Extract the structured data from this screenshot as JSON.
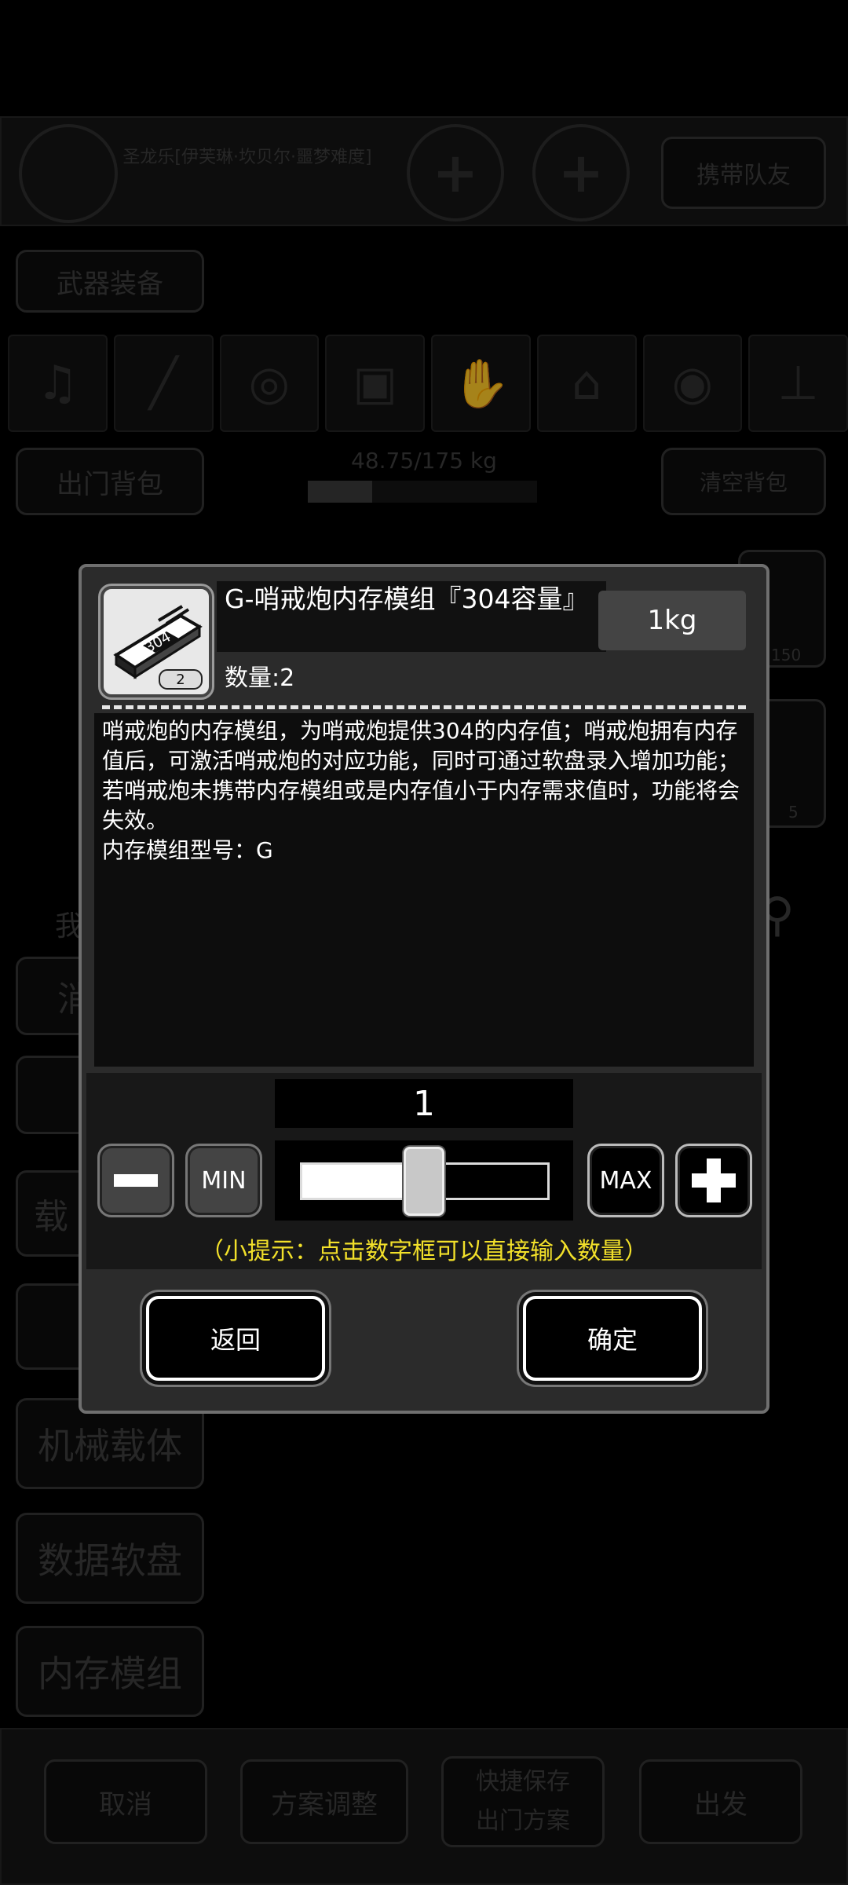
{
  "background": {
    "character_name": "圣龙乐[伊芙琳·坎贝尔·噩梦难度]",
    "carry_teammate_label": "携带队友",
    "weapon_equipment_label": "武器装备",
    "backpack_label": "出门背包",
    "weight_text": "48.75/175 kg",
    "clear_backpack_label": "清空背包",
    "right_slot_count_1": "150",
    "right_slot_count_2": "5",
    "left_partial_labels": [
      "我",
      "消",
      "载"
    ],
    "category_tabs": [
      "机械载体",
      "数据软盘",
      "内存模组"
    ],
    "bottom_buttons": [
      "取消",
      "方案调整",
      "快捷保存\n出门方案",
      "出发"
    ]
  },
  "dialog": {
    "item_name": "G-哨戒炮内存模组『304容量』",
    "item_icon_count": "2",
    "item_icon_label": "304",
    "weight": "1kg",
    "quantity_label": "数量:2",
    "description": "哨戒炮的内存模组，为哨戒炮提供304的内存值；哨戒炮拥有内存值后，可激活哨戒炮的对应功能，同时可通过软盘录入增加功能；若哨戒炮未携带内存模组或是内存值小于内存需求值时，功能将会失效。\n内存模组型号：G",
    "selected_quantity": "1",
    "slider_fraction": 0.5,
    "min_label": "MIN",
    "max_label": "MAX",
    "tip": "（小提示：点击数字框可以直接输入数量）",
    "back_label": "返回",
    "confirm_label": "确定"
  }
}
